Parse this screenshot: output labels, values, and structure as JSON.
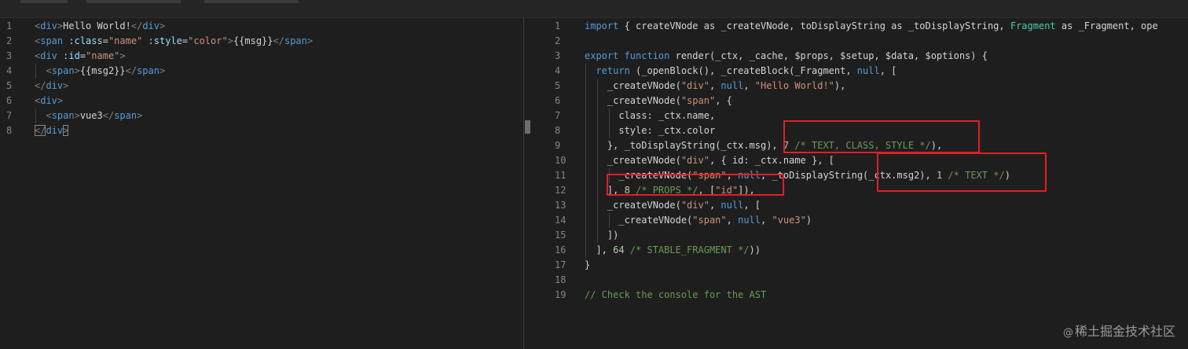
{
  "left_editor": {
    "lines": [
      {
        "n": "1",
        "tokens": [
          {
            "t": "<",
            "c": "br"
          },
          {
            "t": "div",
            "c": "tag"
          },
          {
            "t": ">",
            "c": "br"
          },
          {
            "t": "Hello World!",
            "c": "pl"
          },
          {
            "t": "</",
            "c": "br"
          },
          {
            "t": "div",
            "c": "tag"
          },
          {
            "t": ">",
            "c": "br"
          }
        ]
      },
      {
        "n": "2",
        "tokens": [
          {
            "t": "<",
            "c": "br"
          },
          {
            "t": "span",
            "c": "tag"
          },
          {
            "t": " :class",
            "c": "attr"
          },
          {
            "t": "=",
            "c": "pl"
          },
          {
            "t": "\"name\"",
            "c": "str"
          },
          {
            "t": " :style",
            "c": "attr"
          },
          {
            "t": "=",
            "c": "pl"
          },
          {
            "t": "\"color\"",
            "c": "str"
          },
          {
            "t": ">",
            "c": "br"
          },
          {
            "t": "{{msg}}",
            "c": "pl"
          },
          {
            "t": "</",
            "c": "br"
          },
          {
            "t": "span",
            "c": "tag"
          },
          {
            "t": ">",
            "c": "br"
          }
        ]
      },
      {
        "n": "3",
        "tokens": [
          {
            "t": "<",
            "c": "br"
          },
          {
            "t": "div",
            "c": "tag"
          },
          {
            "t": " :id",
            "c": "attr"
          },
          {
            "t": "=",
            "c": "pl"
          },
          {
            "t": "\"name\"",
            "c": "str"
          },
          {
            "t": ">",
            "c": "br"
          }
        ]
      },
      {
        "n": "4",
        "tokens": [
          {
            "t": "  <",
            "c": "br"
          },
          {
            "t": "span",
            "c": "tag"
          },
          {
            "t": ">",
            "c": "br"
          },
          {
            "t": "{{msg2}}",
            "c": "pl"
          },
          {
            "t": "</",
            "c": "br"
          },
          {
            "t": "span",
            "c": "tag"
          },
          {
            "t": ">",
            "c": "br"
          }
        ]
      },
      {
        "n": "5",
        "tokens": [
          {
            "t": "</",
            "c": "br"
          },
          {
            "t": "div",
            "c": "tag"
          },
          {
            "t": ">",
            "c": "br"
          }
        ]
      },
      {
        "n": "6",
        "tokens": [
          {
            "t": "<",
            "c": "br"
          },
          {
            "t": "div",
            "c": "tag"
          },
          {
            "t": ">",
            "c": "br"
          }
        ]
      },
      {
        "n": "7",
        "tokens": [
          {
            "t": "  <",
            "c": "br"
          },
          {
            "t": "span",
            "c": "tag"
          },
          {
            "t": ">",
            "c": "br"
          },
          {
            "t": "vue3",
            "c": "pl"
          },
          {
            "t": "</",
            "c": "br"
          },
          {
            "t": "span",
            "c": "tag"
          },
          {
            "t": ">",
            "c": "br"
          }
        ]
      },
      {
        "n": "8",
        "tokens": [
          {
            "t": "</",
            "c": "br"
          },
          {
            "t": "div",
            "c": "tag"
          },
          {
            "t": ">",
            "c": "br"
          }
        ]
      }
    ]
  },
  "right_editor": {
    "lines": [
      {
        "n": "1",
        "tokens": [
          {
            "t": "import",
            "c": "kw"
          },
          {
            "t": " { createVNode as _createVNode, toDisplayString as _toDisplayString, ",
            "c": "pl"
          },
          {
            "t": "Fragment",
            "c": "cls"
          },
          {
            "t": " as _Fragment, ope",
            "c": "pl"
          }
        ]
      },
      {
        "n": "2",
        "tokens": []
      },
      {
        "n": "3",
        "tokens": [
          {
            "t": "export function",
            "c": "kw"
          },
          {
            "t": " render(_ctx, _cache, $props, $setup, $data, $options) {",
            "c": "pl"
          }
        ]
      },
      {
        "n": "4",
        "tokens": [
          {
            "t": "  ",
            "c": "pl"
          },
          {
            "t": "return",
            "c": "kw"
          },
          {
            "t": " (_openBlock(), _createBlock(_Fragment, ",
            "c": "pl"
          },
          {
            "t": "null",
            "c": "kw"
          },
          {
            "t": ", [",
            "c": "pl"
          }
        ]
      },
      {
        "n": "5",
        "tokens": [
          {
            "t": "    _createVNode(",
            "c": "pl"
          },
          {
            "t": "\"div\"",
            "c": "str"
          },
          {
            "t": ", ",
            "c": "pl"
          },
          {
            "t": "null",
            "c": "kw"
          },
          {
            "t": ", ",
            "c": "pl"
          },
          {
            "t": "\"Hello World!\"",
            "c": "str"
          },
          {
            "t": "),",
            "c": "pl"
          }
        ]
      },
      {
        "n": "6",
        "tokens": [
          {
            "t": "    _createVNode(",
            "c": "pl"
          },
          {
            "t": "\"span\"",
            "c": "str"
          },
          {
            "t": ", {",
            "c": "pl"
          }
        ]
      },
      {
        "n": "7",
        "tokens": [
          {
            "t": "      class: _ctx.name,",
            "c": "pl"
          }
        ]
      },
      {
        "n": "8",
        "tokens": [
          {
            "t": "      style: _ctx.color",
            "c": "pl"
          }
        ]
      },
      {
        "n": "9",
        "tokens": [
          {
            "t": "    }, _toDisplayString(_ctx.msg), ",
            "c": "pl"
          },
          {
            "t": "7",
            "c": "num"
          },
          {
            "t": " /* TEXT, CLASS, STYLE */",
            "c": "cm"
          },
          {
            "t": "),",
            "c": "pl"
          }
        ]
      },
      {
        "n": "10",
        "tokens": [
          {
            "t": "    _createVNode(",
            "c": "pl"
          },
          {
            "t": "\"div\"",
            "c": "str"
          },
          {
            "t": ", { id: _ctx.name }, [",
            "c": "pl"
          }
        ]
      },
      {
        "n": "11",
        "tokens": [
          {
            "t": "      _createVNode(",
            "c": "pl"
          },
          {
            "t": "\"span\"",
            "c": "str"
          },
          {
            "t": ", ",
            "c": "pl"
          },
          {
            "t": "null",
            "c": "kw"
          },
          {
            "t": ", _toDisplayString(_ctx.msg2), ",
            "c": "pl"
          },
          {
            "t": "1",
            "c": "num"
          },
          {
            "t": " /* TEXT */",
            "c": "cm"
          },
          {
            "t": ")",
            "c": "pl"
          }
        ]
      },
      {
        "n": "12",
        "tokens": [
          {
            "t": "    ], ",
            "c": "pl"
          },
          {
            "t": "8",
            "c": "num"
          },
          {
            "t": " /* PROPS */",
            "c": "cm"
          },
          {
            "t": ", [",
            "c": "pl"
          },
          {
            "t": "\"id\"",
            "c": "str"
          },
          {
            "t": "]),",
            "c": "pl"
          }
        ]
      },
      {
        "n": "13",
        "tokens": [
          {
            "t": "    _createVNode(",
            "c": "pl"
          },
          {
            "t": "\"div\"",
            "c": "str"
          },
          {
            "t": ", ",
            "c": "pl"
          },
          {
            "t": "null",
            "c": "kw"
          },
          {
            "t": ", [",
            "c": "pl"
          }
        ]
      },
      {
        "n": "14",
        "tokens": [
          {
            "t": "      _createVNode(",
            "c": "pl"
          },
          {
            "t": "\"span\"",
            "c": "str"
          },
          {
            "t": ", ",
            "c": "pl"
          },
          {
            "t": "null",
            "c": "kw"
          },
          {
            "t": ", ",
            "c": "pl"
          },
          {
            "t": "\"vue3\"",
            "c": "str"
          },
          {
            "t": ")",
            "c": "pl"
          }
        ]
      },
      {
        "n": "15",
        "tokens": [
          {
            "t": "    ])",
            "c": "pl"
          }
        ]
      },
      {
        "n": "16",
        "tokens": [
          {
            "t": "  ], ",
            "c": "pl"
          },
          {
            "t": "64",
            "c": "num"
          },
          {
            "t": " /* STABLE_FRAGMENT */",
            "c": "cm"
          },
          {
            "t": "))",
            "c": "pl"
          }
        ]
      },
      {
        "n": "17",
        "tokens": [
          {
            "t": "}",
            "c": "pl"
          }
        ]
      },
      {
        "n": "18",
        "tokens": []
      },
      {
        "n": "19",
        "tokens": [
          {
            "t": "// Check the console for the AST",
            "c": "cm"
          }
        ]
      }
    ]
  },
  "watermark": {
    "symbol": "@",
    "text": "稀土掘金技术社区"
  },
  "colors": {
    "highlight": "#e31e24",
    "background": "#1e1e1e"
  }
}
